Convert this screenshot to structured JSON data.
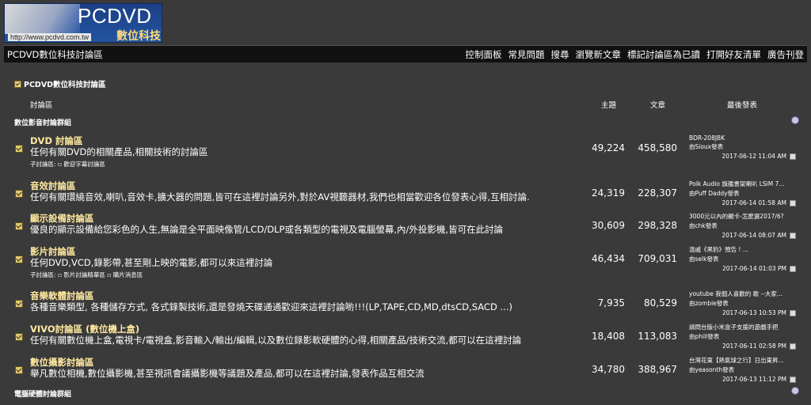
{
  "logo": {
    "name": "PCDVD",
    "sub": "數位科技",
    "url": "http://www.pcdvd.com.tw"
  },
  "nav": {
    "site_title": "PCDVD數位科技討論區",
    "links": [
      "控制面板",
      "常見問題",
      "搜尋",
      "瀏覽新文章",
      "標記討論區為已讀",
      "打開好友清單",
      "廣告刊登"
    ]
  },
  "breadcrumb": "PCDVD數位科技討論區",
  "columns": {
    "forum": "討論區",
    "threads": "主題",
    "posts": "文章",
    "last": "最後發表"
  },
  "groups": [
    "數位影音討論群組",
    "電腦硬體討論群組"
  ],
  "forums": [
    {
      "name": "DVD 討論區",
      "desc": "任何有關DVD的相關產品,相關技術的討論區",
      "subs_label": "子討論區:",
      "subs": [
        "歡迎字幕討論區"
      ],
      "threads": "49,224",
      "posts": "458,580",
      "last_title": "BDR-208JBK",
      "last_by": "由Sioux發表",
      "last_date": "2017-06-12",
      "last_time": "11:04 AM"
    },
    {
      "name": "音效討論區",
      "desc": "任何有關環繞音效,喇叭,音效卡,擴大器的問題,皆可在這裡討論另外,對於AV視聽器材,我們也相當歡迎各位發表心得,互相討論.",
      "subs_label": "",
      "subs": [],
      "threads": "24,319",
      "posts": "228,307",
      "last_title": "Polk Audio 旗艦書架喇叭 LSiM 7...",
      "last_by": "由Puff Daddy發表",
      "last_date": "2017-06-14",
      "last_time": "01:58 AM"
    },
    {
      "name": "顯示設備討論區",
      "desc": "優良的顯示設備給您彩色的人生,無論是全平面映像管/LCD/DLP或各類型的電視及電腦螢幕,內/外投影機,皆可在此討論",
      "subs_label": "",
      "subs": [],
      "threads": "30,609",
      "posts": "298,328",
      "last_title": "3000元以內的顯卡-怎麼選2017/6?",
      "last_by": "由chk發表",
      "last_date": "2017-06-14",
      "last_time": "08:07 AM"
    },
    {
      "name": "影片討論區",
      "desc": "任何DVD,VCD,錄影帶,甚至剛上映的電影,都可以來這裡討論",
      "subs_label": "子討論區:",
      "subs": [
        "影片討論精華區",
        "購片消息區"
      ],
      "threads": "46,434",
      "posts": "709,031",
      "last_title": "溫戚《黑豹》預告 ! ...",
      "last_by": "由selk發表",
      "last_date": "2017-06-14",
      "last_time": "01:03 PM"
    },
    {
      "name": "音樂軟體討論區",
      "desc": "各種音樂類型, 各種儲存方式, 各式錄製技術,還是發燒天碟通通歡迎來這裡討論喲!!!(LP,TAPE,CD,MD,dtsCD,SACD ...)",
      "subs_label": "",
      "subs": [],
      "threads": "7,935",
      "posts": "80,529",
      "last_title": "youtube 我個人喜歡的 歌 --大家...",
      "last_by": "由zombie發表",
      "last_date": "2017-06-13",
      "last_time": "10:53 PM"
    },
    {
      "name": "VIVO討論區 (數位機上盒)",
      "desc": "任何有關數位機上盒,電視卡/電視盒,影音輸入/輸出/編輯,以及數位錄影軟硬體的心得,相關產品/技術交流,都可以在這裡討論",
      "subs_label": "",
      "subs": [],
      "threads": "18,408",
      "posts": "113,083",
      "last_title": "請問台版小米盒子支援的遊戲手把",
      "last_by": "由phill發表",
      "last_date": "2017-06-11",
      "last_time": "02:58 PM"
    },
    {
      "name": "數位攝影討論區",
      "desc": "舉凡數位相機,數位攝影機,甚至視訊會議攝影機等議題及產品,都可以在這裡討論,發表作品互相交流",
      "subs_label": "",
      "subs": [],
      "threads": "34,780",
      "posts": "388,967",
      "last_title": "台灣花東【熱氣球之行】日出東昇...",
      "last_by": "由yeasonth發表",
      "last_date": "2017-06-13",
      "last_time": "11:12 PM"
    }
  ]
}
